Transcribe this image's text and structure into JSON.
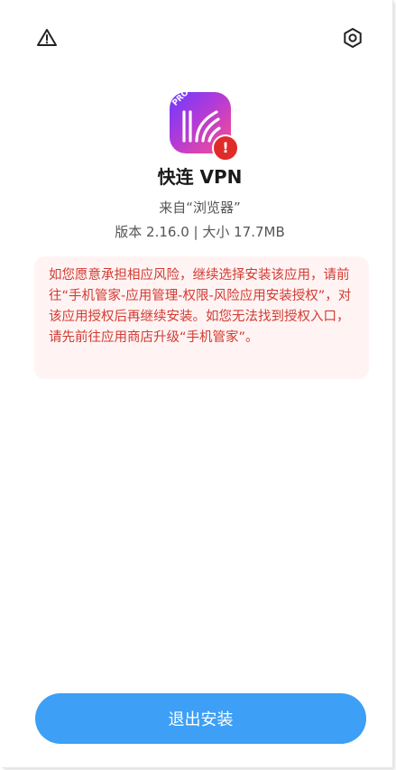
{
  "header": {
    "left_icon": "warning-icon",
    "right_icon": "settings-icon"
  },
  "app": {
    "icon": "app-logo",
    "icon_badge_text": "PRO",
    "alert_badge": "!",
    "name": "快连 VPN",
    "source": "来自“浏览器”",
    "version_info": "版本 2.16.0 | 大小 17.7MB"
  },
  "warning": {
    "text": "如您愿意承担相应风险，继续选择安装该应用，请前往“手机管家-应用管理-权限-风险应用安装授权”，对该应用授权后再继续安装。如您无法找到授权入口，请先前往应用商店升级“手机管家”。",
    "color": "#d23a33",
    "background": "#fff4f3"
  },
  "footer": {
    "exit_label": "退出安装",
    "button_color": "#3d9ff5"
  }
}
